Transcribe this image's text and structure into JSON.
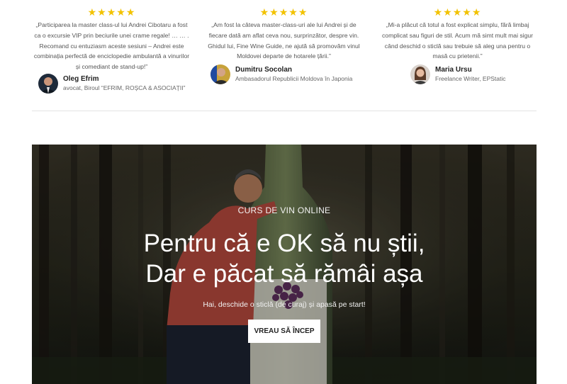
{
  "testimonials": [
    {
      "stars": "★★★★★",
      "quote": "„Participarea la master class-ul lui Andrei Cibotaru a fost ca o excursie VIP prin beciurile unei crame regale! … … . Recomand cu entuziasm aceste sesiuni – Andrei este combinația perfectă de enciclopedie ambulantă a vinurilor și comediant de stand-up!”",
      "name": "Oleg Efrim",
      "role": "avocat, Biroul “EFRIM, ROȘCA & ASOCIAȚII”"
    },
    {
      "stars": "★★★★★",
      "quote": "„Am fost la câteva master-class-uri ale lui Andrei și de fiecare dată am aflat ceva nou, surprinzător, despre vin. Ghidul lui, Fine Wine Guide, ne ajută să promovăm vinul Moldovei departe de hotarele țării.”",
      "name": "Dumitru Socolan",
      "role": "Ambasadorul Republicii Moldova în Japonia"
    },
    {
      "stars": "★★★★★",
      "quote": "„Mi-a plăcut că totul a fost explicat simplu, fără limbaj complicat sau figuri de stil. Acum mă simt mult mai sigur când deschid o sticlă sau trebuie să aleg una pentru o masă cu prietenii.”",
      "name": "Maria Ursu",
      "role": "Freelance Writer, EPStatic"
    }
  ],
  "hero": {
    "eyebrow": "CURS DE VIN ONLINE",
    "headline_line1": "Pentru că e OK să nu știi,",
    "headline_line2": "Dar e păcat să rămâi așa",
    "subtext": "Hai, deschide o sticlă (de curaj) și apasă pe start!",
    "cta_label": "VREAU SĂ ÎNCEP"
  },
  "colors": {
    "star": "#f2c200",
    "cta_bg": "#ffffff",
    "hero_text": "#ffffff"
  }
}
